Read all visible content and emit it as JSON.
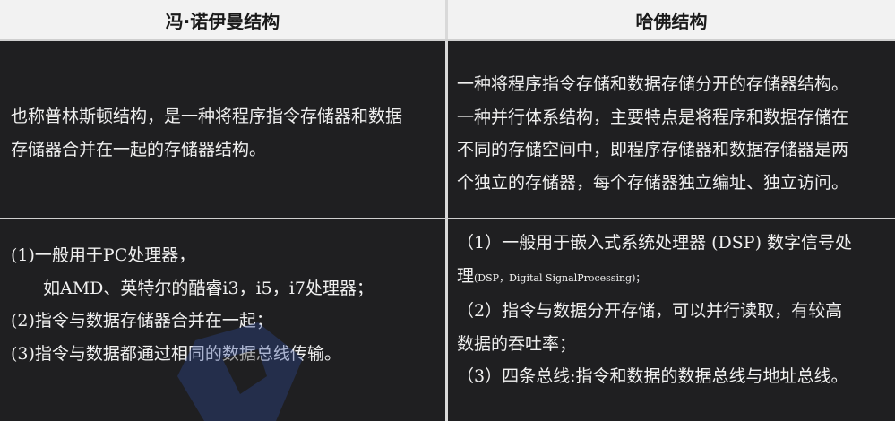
{
  "headers": {
    "left": "冯·诺伊曼结构",
    "right": "哈佛结构"
  },
  "row1": {
    "left_lines": [
      "也称普林斯顿结构，是一种将程序指令存储器和数据",
      "存储器合并在一起的存储器结构。"
    ],
    "right_lines": [
      "一种将程序指令存储和数据存储分开的存储器结构。",
      "一种并行体系结构，主要特点是将程序和数据存储在",
      "不同的存储空间中，即程序存储器和数据存储器是两",
      "个独立的存储器，每个存储器独立编址、独立访问。"
    ]
  },
  "row2": {
    "left_lines": [
      "(1)一般用于PC处理器，",
      "如AMD、英特尔的酷睿i3，i5，i7处理器；",
      "(2)指令与数据存储器合并在一起；",
      "(3)指令与数据都通过相同的数据总线传输。"
    ],
    "right_lines": {
      "line1": "（1）一般用于嵌入式系统处理器 (DSP) 数字信号处",
      "line2_prefix": "理",
      "line2_small": "(DSP，Digital SignalProcessing)；",
      "line3": "（2）指令与数据分开存储，可以并行读取，有较高",
      "line4": "数据的吞吐率；",
      "line5": "（3）四条总线:指令和数据的数据总线与地址总线。"
    }
  },
  "colors": {
    "header_bg": "#f2f2f2",
    "body_bg": "#1f1f21",
    "grid": "#d9d9d9",
    "text": "#f0f0f0",
    "watermark": "#2f4a9a"
  }
}
